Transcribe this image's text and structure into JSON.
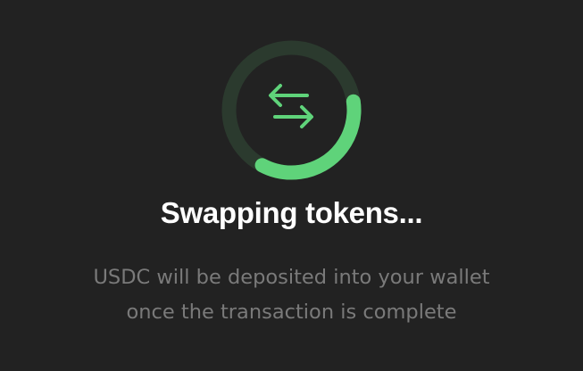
{
  "swap_status": {
    "progress": 0.35,
    "accent_color": "#5fd37a",
    "track_color": "#2b3a2e",
    "icon": "swap-arrows-icon",
    "title": "Swapping tokens...",
    "description_lines": [
      "USDC will be deposited into your wallet",
      "once the transaction is complete"
    ]
  }
}
